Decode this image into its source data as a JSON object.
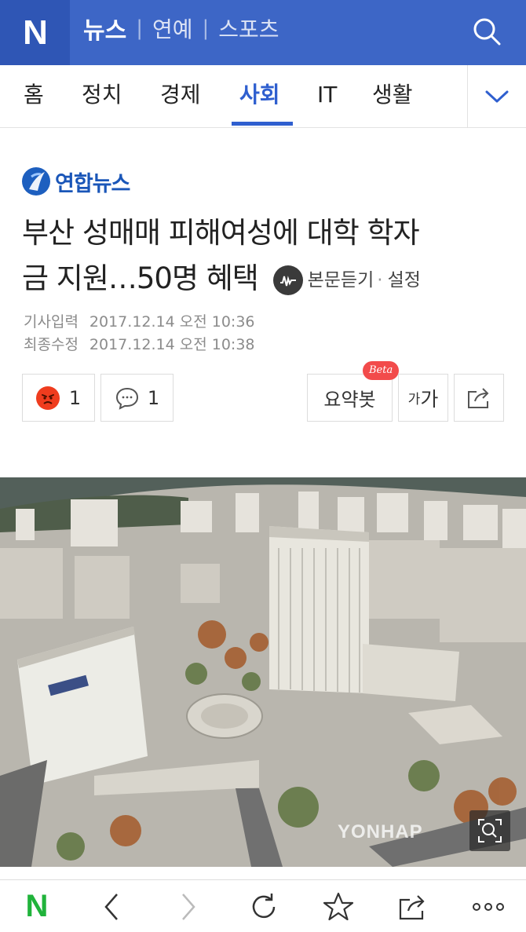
{
  "header": {
    "logo": "N",
    "nav": [
      "뉴스",
      "연예",
      "스포츠"
    ]
  },
  "tabs": [
    "홈",
    "정치",
    "경제",
    "사회",
    "IT",
    "생활"
  ],
  "active_tab": "사회",
  "article": {
    "press": "연합뉴스",
    "title_line1": "부산 성매매 피해여성에 대학 학자",
    "title_line2": "금 지원…50명 혜택",
    "tts_label": "본문듣기",
    "settings_label": "설정",
    "published_label": "기사입력",
    "published": "2017.12.14 오전 10:36",
    "modified_label": "최종수정",
    "modified": "2017.12.14 오전 10:38"
  },
  "actions": {
    "reaction_count": "1",
    "comment_count": "1",
    "summary_label": "요약봇",
    "summary_badge": "Beta",
    "font_small": "가",
    "font_large": "가"
  },
  "photo": {
    "watermark": "YONHAP"
  },
  "colors": {
    "header_bg": "#3d66c6",
    "logo_bg": "#2f56b5",
    "active_tab": "#2f5fcf",
    "naver_green": "#20b33b",
    "reaction_red": "#ef3c1e"
  },
  "bottom_bar": [
    "naver-home-icon",
    "back-icon",
    "forward-icon",
    "refresh-icon",
    "star-icon",
    "share-icon",
    "more-icon"
  ]
}
